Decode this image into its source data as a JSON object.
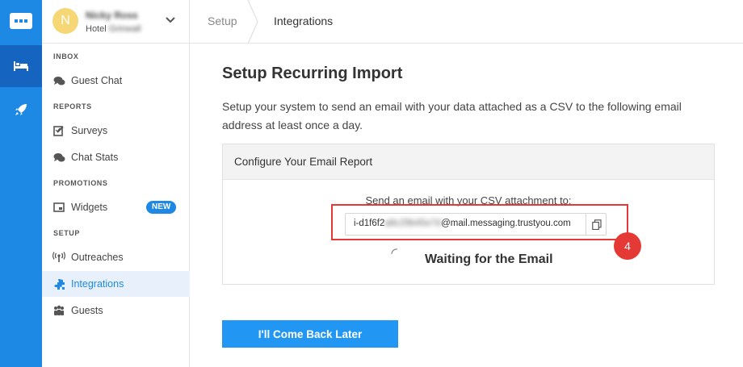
{
  "rail": {
    "items": [
      {
        "icon": "chat-logo-icon"
      },
      {
        "icon": "hotel-bed-icon",
        "active": true
      },
      {
        "icon": "rocket-icon"
      }
    ]
  },
  "user": {
    "initial": "N",
    "name": "Nicky Ross",
    "hotel_prefix": "Hotel",
    "hotel_name": "Grinwall",
    "avatar_color": "#f6d776"
  },
  "sidebar": {
    "sections": {
      "inbox": "INBOX",
      "reports": "REPORTS",
      "promotions": "PROMOTIONS",
      "setup": "SETUP"
    },
    "items": {
      "guest_chat": "Guest Chat",
      "surveys": "Surveys",
      "chat_stats": "Chat Stats",
      "widgets": "Widgets",
      "widgets_badge": "NEW",
      "outreaches": "Outreaches",
      "integrations": "Integrations",
      "guests": "Guests"
    },
    "active_item": "Integrations"
  },
  "breadcrumb": {
    "parent": "Setup",
    "current": "Integrations"
  },
  "main": {
    "title": "Setup Recurring Import",
    "description": "Setup your system to send an email with your data attached as a CSV to the following email address at least once a day.",
    "card": {
      "title": "Configure Your Email Report",
      "send_label": "Send an email with your CSV attachment to:",
      "email_prefix": "i-d1f6f2",
      "email_hidden": "a8c29b45e7d",
      "email_domain": "@mail.messaging.trustyou.com",
      "status": "Waiting for the Email"
    },
    "later_button": "I'll Come Back Later"
  },
  "annotation": {
    "step_number": "4",
    "color": "#e53935"
  },
  "colors": {
    "brand": "#1e88e5",
    "button": "#2196f3"
  }
}
